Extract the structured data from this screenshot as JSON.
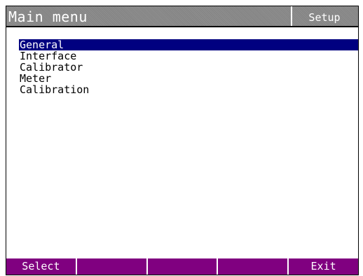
{
  "header": {
    "title": "Main menu",
    "context_label": "Setup"
  },
  "menu": {
    "selected_index": 0,
    "items": [
      {
        "label": "General"
      },
      {
        "label": "Interface"
      },
      {
        "label": "Calibrator"
      },
      {
        "label": "Meter"
      },
      {
        "label": "Calibration"
      }
    ]
  },
  "softkeys": [
    {
      "label": "Select"
    },
    {
      "label": ""
    },
    {
      "label": ""
    },
    {
      "label": ""
    },
    {
      "label": "Exit"
    }
  ],
  "colors": {
    "title_bar": "#8a8a8a",
    "selection": "#000080",
    "softkey_bar": "#800080",
    "text": "#000000"
  }
}
